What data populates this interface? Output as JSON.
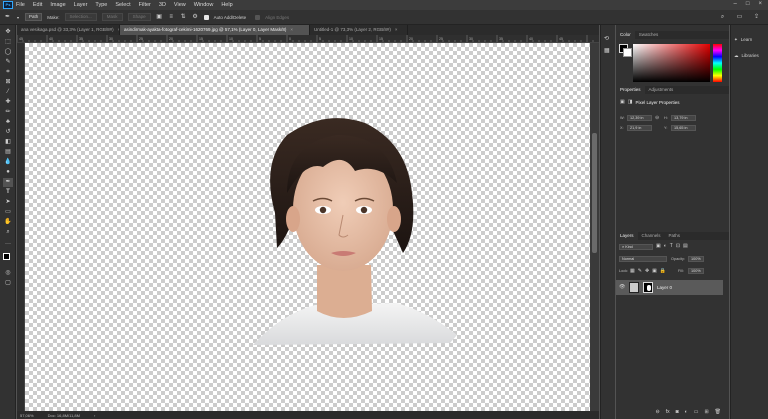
{
  "app": {
    "logo_text": "Ps",
    "accent": "#31a8ff"
  },
  "menu": {
    "items": [
      "File",
      "Edit",
      "Image",
      "Layer",
      "Type",
      "Select",
      "Filter",
      "3D",
      "View",
      "Window",
      "Help"
    ]
  },
  "options_bar": {
    "mode_value": "Path",
    "make_label": "Make:",
    "selection_label": "Selection...",
    "mask_label": "Mask",
    "shape_label": "Shape",
    "auto_add_delete_label": "Auto Add/Delete",
    "align_edges_label": "Align Edges"
  },
  "doc_tabs": [
    {
      "label": "ana vesikaga.psd @ 33,3% (Layer 1, RGB/8#)",
      "close": "×"
    },
    {
      "label": "asindirmak-ayakta-fotograf-cekimi-1620769.jpg @ 57,1% (Layer 0, Layer Mask/8)",
      "close": "×"
    },
    {
      "label": "Untitled-1 @ 73,3% (Layer 2, RGB/8#)",
      "close": "×"
    }
  ],
  "ruler_labels": [
    "45",
    "40",
    "35",
    "30",
    "25",
    "20",
    "15",
    "10",
    "5",
    "0",
    "5",
    "10",
    "15",
    "20",
    "25",
    "30",
    "35",
    "40",
    "45"
  ],
  "status": {
    "zoom": "57,06%",
    "doc": "Doc: 16,8M/11,8M"
  },
  "color_panel": {
    "tabs": [
      "Color",
      "Swatches"
    ],
    "hue_color": "#e00000"
  },
  "properties_panel": {
    "tabs": [
      "Properties",
      "Adjustments"
    ],
    "title": "Pixel Layer Properties",
    "w_label": "W:",
    "w_value": "12,39 in",
    "h_label": "H:",
    "h_value": "13,79 in",
    "x_label": "X:",
    "x_value": "21,9 in",
    "y_label": "Y:",
    "y_value": "15,65 in"
  },
  "layers_panel": {
    "tabs": [
      "Layers",
      "Channels",
      "Paths"
    ],
    "kind_label": "Kind",
    "blend_mode": "Normal",
    "opacity_label": "Opacity:",
    "opacity_value": "100%",
    "lock_label": "Lock:",
    "fill_label": "Fill:",
    "fill_value": "100%",
    "layer_name": "Layer 0"
  },
  "right_strip": {
    "learn_label": "Learn",
    "libraries_label": "Libraries"
  }
}
